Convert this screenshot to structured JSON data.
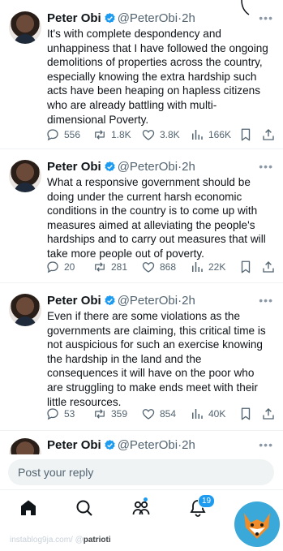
{
  "colors": {
    "accent": "#1d9bf0",
    "muted": "#536471",
    "verified": "#1d9bf0"
  },
  "tweets": [
    {
      "name": "Peter Obi",
      "handle": "@PeterObi",
      "time": "2h",
      "text": "It's with complete despondency and\nunhappiness that I have followed the ongoing\ndemolitions of properties across the country,\nespecially knowing the extra hardship such\nacts have been heaping on hapless citizens\nwho are already battling with multi-\ndimensional Poverty.",
      "replies": "556",
      "reposts": "1.8K",
      "likes": "3.8K",
      "views": "166K"
    },
    {
      "name": "Peter Obi",
      "handle": "@PeterObi",
      "time": "2h",
      "text": "What a responsive government should be\ndoing under the current harsh economic\nconditions  in the country is to come up with\nmeasures aimed at alleviating the people's\nhardships and to carry out measures that will\ntake more people out of poverty.",
      "replies": "20",
      "reposts": "281",
      "likes": "868",
      "views": "22K"
    },
    {
      "name": "Peter Obi",
      "handle": "@PeterObi",
      "time": "2h",
      "text": "Even if there are some violations as the\ngovernments are claiming, this critical time is\nnot auspicious for such an exercise knowing\nthe hardship in the land and the\nconsequences it will have on the poor who\nare struggling to make ends meet with their\nlittle resources.",
      "replies": "53",
      "reposts": "359",
      "likes": "854",
      "views": "40K"
    },
    {
      "name": "Peter Obi",
      "handle": "@PeterObi",
      "time": "2h"
    }
  ],
  "reply_placeholder": "Post your reply",
  "nav": {
    "notifications_badge": "19"
  },
  "watermark": {
    "prefix": "instablog9ja.com/ @",
    "name": "patrioti"
  },
  "icons": [
    "verified-icon",
    "more-icon",
    "reply-icon",
    "repost-icon",
    "like-icon",
    "views-icon",
    "bookmark-icon",
    "share-icon",
    "home-icon",
    "search-icon",
    "communities-icon",
    "notifications-icon"
  ]
}
